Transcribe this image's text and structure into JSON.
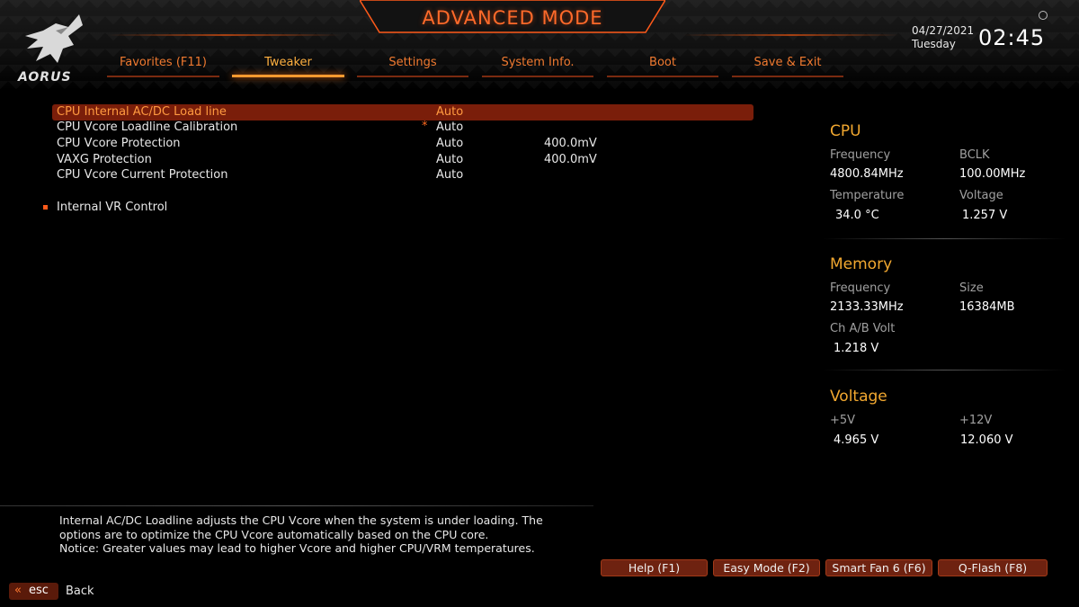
{
  "header": {
    "mode_title": "ADVANCED MODE",
    "logo_text": "AORUS",
    "date": "04/27/2021",
    "day": "Tuesday",
    "time": "02:45"
  },
  "tabs": [
    {
      "label": "Favorites (F11)"
    },
    {
      "label": "Tweaker"
    },
    {
      "label": "Settings"
    },
    {
      "label": "System Info."
    },
    {
      "label": "Boot"
    },
    {
      "label": "Save & Exit"
    }
  ],
  "active_tab": "Tweaker",
  "settings": [
    {
      "label": "CPU Internal AC/DC Load line",
      "value": "Auto",
      "extra": "",
      "star": ""
    },
    {
      "label": "CPU Vcore Loadline Calibration",
      "value": "Auto",
      "extra": "",
      "star": "*"
    },
    {
      "label": "CPU Vcore Protection",
      "value": "Auto",
      "extra": "400.0mV",
      "star": ""
    },
    {
      "label": "VAXG Protection",
      "value": "Auto",
      "extra": "400.0mV",
      "star": ""
    },
    {
      "label": "CPU Vcore Current Protection",
      "value": "Auto",
      "extra": "",
      "star": ""
    }
  ],
  "submenu": {
    "label": "Internal VR Control"
  },
  "info": {
    "cpu": {
      "title": "CPU",
      "freq_label": "Frequency",
      "freq": "4800.84MHz",
      "bclk_label": "BCLK",
      "bclk": "100.00MHz",
      "temp_label": "Temperature",
      "temp": "34.0 °C",
      "volt_label": "Voltage",
      "volt": "1.257 V"
    },
    "memory": {
      "title": "Memory",
      "freq_label": "Frequency",
      "freq": "2133.33MHz",
      "size_label": "Size",
      "size": "16384MB",
      "chv_label": "Ch A/B Volt",
      "chv": "1.218 V"
    },
    "voltage": {
      "title": "Voltage",
      "v5_label": "+5V",
      "v5": "4.965 V",
      "v12_label": "+12V",
      "v12": "12.060 V"
    }
  },
  "help": {
    "line1": "Internal AC/DC Loadline adjusts the CPU Vcore when the system is under loading. The",
    "line2": "options are to optimize the CPU Vcore automatically based on the CPU core.",
    "line3": "Notice: Greater values may lead to higher Vcore and higher CPU/VRM temperatures."
  },
  "buttons": {
    "help": "Help (F1)",
    "easy": "Easy Mode (F2)",
    "smartfan": "Smart Fan 6 (F6)",
    "qflash": "Q-Flash (F8)"
  },
  "footer": {
    "esc": "esc",
    "back": "Back"
  },
  "colors": {
    "accent": "#ff6a2a",
    "heading": "#f2a830",
    "selected_row": "#7a1e0a"
  }
}
